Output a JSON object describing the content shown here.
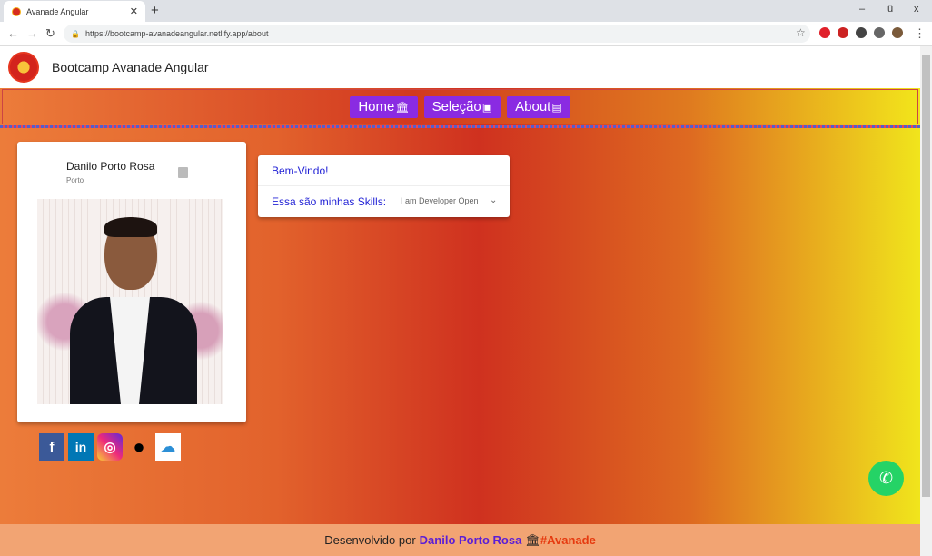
{
  "browser": {
    "tab_title": "Avanade Angular",
    "url": "https://bootcamp-avanadeangular.netlify.app/about",
    "newtab_icon": "+",
    "minimize": "–",
    "restore": "ü",
    "close": "x"
  },
  "header": {
    "title": "Bootcamp Avanade Angular"
  },
  "nav": {
    "items": [
      {
        "label": "Home",
        "icon": "🏛"
      },
      {
        "label": "Seleção",
        "icon": "▣"
      },
      {
        "label": "About",
        "icon": "▤"
      }
    ]
  },
  "profile": {
    "name": "Danilo Porto Rosa",
    "city": "Porto"
  },
  "info": {
    "welcome": "Bem-Vindo!",
    "skills_label": "Essa são minhas Skills:",
    "skills_value": "I am Developer Open"
  },
  "social": {
    "facebook": "f",
    "linkedin": "in",
    "instagram": "◎",
    "github": "●",
    "cv": "☁"
  },
  "footer": {
    "prefix": "Desenvolvido por",
    "author": "Danilo Porto Rosa",
    "icon": "🏛",
    "tag": "#Avanade"
  },
  "colors": {
    "nav_button": "#8a2be2",
    "link": "#2424d6",
    "whatsapp": "#25d366"
  }
}
